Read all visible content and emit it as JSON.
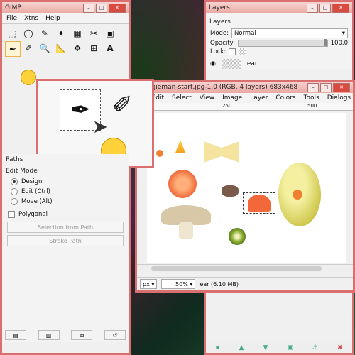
{
  "toolbox": {
    "title": "GIMP",
    "menu": [
      "File",
      "Xtns",
      "Help"
    ],
    "paths_label": "Paths",
    "edit_mode_label": "Edit Mode",
    "modes": [
      "Design",
      "Edit (Ctrl)",
      "Move (Alt)"
    ],
    "selected_mode": "Design",
    "polygonal_label": "Polygonal",
    "selection_from_path": "Selection from Path",
    "stroke_path": "Stroke Path"
  },
  "layers": {
    "title": "Layers",
    "tab_label": "Layers",
    "mode_label": "Mode:",
    "mode_value": "Normal",
    "opacity_label": "Opacity:",
    "opacity_value": "100.0",
    "lock_label": "Lock:",
    "layer_name": "ear"
  },
  "image": {
    "title": "veggieman-start.jpg-1.0 (RGB, 4 layers) 683x468",
    "menu": [
      "e",
      "Edit",
      "Select",
      "View",
      "Image",
      "Layer",
      "Colors",
      "Tools",
      "Dialogs"
    ],
    "ruler_labels": [
      "250",
      "500"
    ],
    "unit": "px",
    "zoom": "50%",
    "status": "ear (6.10 MB)"
  },
  "colors": {
    "window_border": "#d9706f",
    "titlebar": "#e9a8a3",
    "close_button": "#d94a3f"
  }
}
